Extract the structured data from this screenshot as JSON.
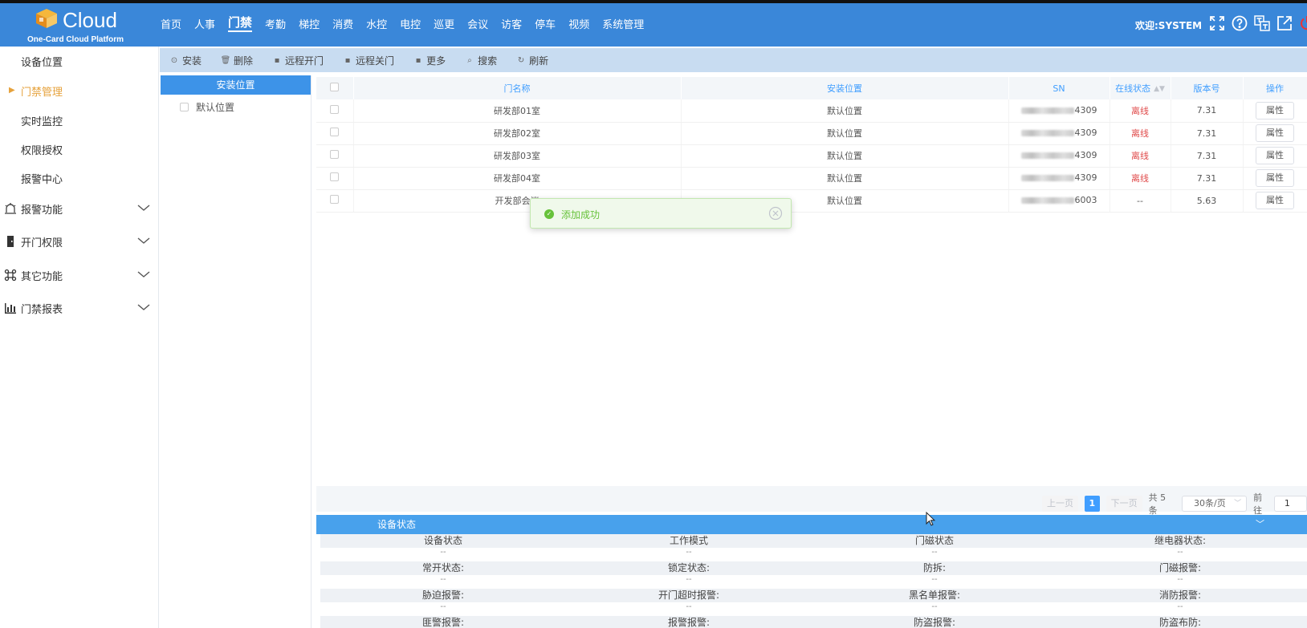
{
  "header": {
    "brand": "Cloud",
    "subtitle": "One-Card Cloud Platform",
    "nav": [
      "首页",
      "人事",
      "门禁",
      "考勤",
      "梯控",
      "消费",
      "水控",
      "电控",
      "巡更",
      "会议",
      "访客",
      "停车",
      "视频",
      "系统管理"
    ],
    "active_nav": "门禁",
    "welcome": "欢迎:SYSTEM",
    "icons": [
      "fullscreen-icon",
      "help-icon",
      "language-icon",
      "external-link-icon",
      "power-icon"
    ]
  },
  "sidebar": {
    "items": [
      {
        "label": "设备位置"
      },
      {
        "label": "门禁管理",
        "active": true
      },
      {
        "label": "实时监控"
      },
      {
        "label": "权限授权"
      },
      {
        "label": "报警中心"
      }
    ],
    "groups": [
      {
        "label": "报警功能",
        "icon": "alarm-icon"
      },
      {
        "label": "开门权限",
        "icon": "door-icon"
      },
      {
        "label": "其它功能",
        "icon": "command-icon"
      },
      {
        "label": "门禁报表",
        "icon": "report-chart-icon"
      }
    ]
  },
  "toolbar": {
    "buttons": [
      {
        "label": "安装",
        "icon": "install-icon"
      },
      {
        "label": "删除",
        "icon": "trash-icon"
      },
      {
        "label": "远程开门",
        "icon": "monitor-icon"
      },
      {
        "label": "远程关门",
        "icon": "monitor-icon"
      },
      {
        "label": "更多",
        "icon": "monitor-icon"
      },
      {
        "label": "搜索",
        "icon": "search-icon"
      },
      {
        "label": "刷新",
        "icon": "refresh-icon"
      }
    ]
  },
  "tree": {
    "title": "安装位置",
    "nodes": [
      "默认位置"
    ]
  },
  "table": {
    "headers": {
      "name": "门名称",
      "location": "安装位置",
      "sn": "SN",
      "status": "在线状态",
      "version": "版本号",
      "action": "操作"
    },
    "rows": [
      {
        "name": "研发部01室",
        "location": "默认位置",
        "sn_suffix": "4309",
        "status": "离线",
        "version": "7.31",
        "action": "属性"
      },
      {
        "name": "研发部02室",
        "location": "默认位置",
        "sn_suffix": "4309",
        "status": "离线",
        "version": "7.31",
        "action": "属性"
      },
      {
        "name": "研发部03室",
        "location": "默认位置",
        "sn_suffix": "4309",
        "status": "离线",
        "version": "7.31",
        "action": "属性"
      },
      {
        "name": "研发部04室",
        "location": "默认位置",
        "sn_suffix": "4309",
        "status": "离线",
        "version": "7.31",
        "action": "属性"
      },
      {
        "name": "开发部会议",
        "location": "默认位置",
        "sn_suffix": "6003",
        "status": "--",
        "version": "5.63",
        "action": "属性"
      }
    ]
  },
  "pagination": {
    "prev": "上一页",
    "current": "1",
    "next": "下一页",
    "total": "共 5 条",
    "page_size": "30条/页",
    "goto_label": "前往",
    "goto_value": "1"
  },
  "device_status": {
    "title": "设备状态",
    "rows": [
      [
        "设备状态",
        "工作模式",
        "门磁状态",
        "继电器状态:"
      ],
      [
        "常开状态:",
        "锁定状态:",
        "防拆:",
        "门磁报警:"
      ],
      [
        "胁迫报警:",
        "开门超时报警:",
        "黑名单报警:",
        "消防报警:"
      ],
      [
        "匪警报警:",
        "报警报警:",
        "防盗报警:",
        "防盗布防:"
      ]
    ],
    "empty_value": "--"
  },
  "toast": {
    "message": "添加成功"
  },
  "colors": {
    "header_bg": "#3a87d9",
    "accent": "#409eff",
    "active_menu": "#e6a23c",
    "offline": "#e04b4b",
    "success": "#67c23a"
  }
}
